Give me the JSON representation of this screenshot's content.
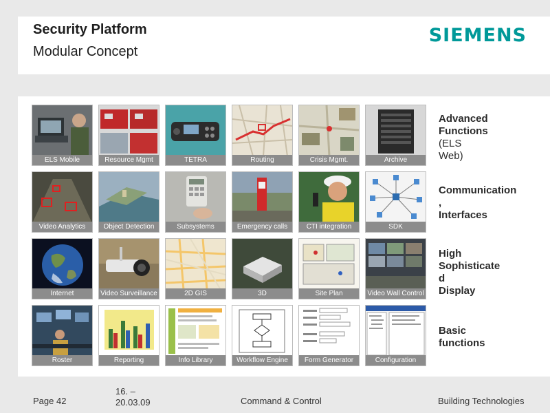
{
  "header": {
    "title": "Security Platform",
    "subtitle": "Modular Concept",
    "logo": "SIEMENS"
  },
  "colors": {
    "brand": "#009999",
    "label_bg": "#8c8c8c"
  },
  "tiles": [
    [
      "ELS Mobile",
      "Resource Mgmt",
      "TETRA",
      "Routing",
      "Crisis Mgmt.",
      "Archive"
    ],
    [
      "Video Analytics",
      "Object Detection",
      "Subsystems",
      "Emergency calls",
      "CTI integration",
      "SDK"
    ],
    [
      "Internet",
      "Video Surveillance",
      "2D GIS",
      "3D",
      "Site Plan",
      "Video Wall Control"
    ],
    [
      "Roster",
      "Reporting",
      "Info Library",
      "Workflow Engine",
      "Form Generator",
      "Configuration"
    ]
  ],
  "categories": {
    "advanced": {
      "line1": "Advanced",
      "line2": "Functions",
      "line3": "(ELS",
      "line4": "Web)"
    },
    "communication": {
      "line1": "Communication",
      "line2": ",",
      "line3": "Interfaces"
    },
    "display": {
      "line1": "High",
      "line2": "Sophisticate",
      "line3": "d",
      "line4": "Display"
    },
    "basic": {
      "line1": "Basic",
      "line2": "functions"
    }
  },
  "footer": {
    "page": "Page 42",
    "date_line1": "16. –",
    "date_line2": "20.03.09",
    "center": "Command & Control",
    "right": "Building Technologies"
  }
}
